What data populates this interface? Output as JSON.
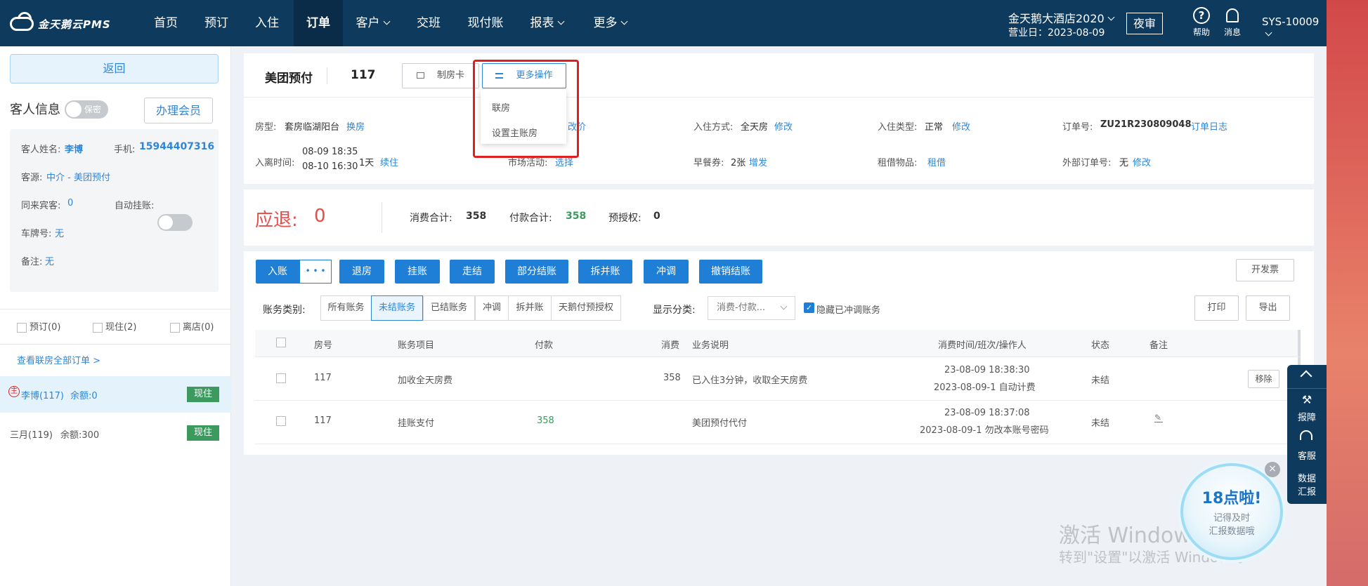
{
  "topbar": {
    "logo_text": "金天鹅云PMS",
    "nav": [
      "首页",
      "预订",
      "入住",
      "订单",
      "客户",
      "交班",
      "现付账",
      "报表",
      "更多"
    ],
    "active_nav": "订单",
    "hotel_name": "金天鹅大酒店2020",
    "business_date": "营业日：2023-08-09",
    "night_audit": "夜审",
    "help": "帮助",
    "messages": "消息",
    "user": "SYS-10009"
  },
  "left": {
    "back": "返回",
    "guest_info_title": "客人信息",
    "privacy": "保密",
    "member_btn": "办理会员",
    "name_label": "客人姓名:",
    "name": "李博",
    "phone_label": "手机:",
    "phone": "15944407316",
    "source_label": "客源:",
    "source": "中介 - 美团预付",
    "companion_label": "同来宾客:",
    "companion": "0",
    "auto_label": "自动挂账:",
    "plate_label": "车牌号:",
    "plate": "无",
    "remark_label": "备注:",
    "remark": "无",
    "tabs": [
      "预订(0)",
      "现住(2)",
      "离店(0)"
    ],
    "view_all": "查看联房全部订单 >",
    "rooms": [
      {
        "mark": "主",
        "name": "李博(117)",
        "balance": "余额:0",
        "status": "现住"
      },
      {
        "name": "三月(119)",
        "balance": "余额:300",
        "status": "现住"
      }
    ]
  },
  "order": {
    "channel": "美团预付",
    "room_no": "117",
    "make_card": "制房卡",
    "more_ops": "更多操作",
    "dropdown": [
      "联房",
      "设置主账房"
    ],
    "room_type_label": "房型:",
    "room_type": "套房临湖阳台",
    "change_room": "换房",
    "change_price": "改价",
    "checkin_method_label": "入住方式:",
    "checkin_method": "全天房",
    "modify": "修改",
    "checkin_type_label": "入住类型:",
    "checkin_type": "正常",
    "order_no_label": "订单号:",
    "order_no": "ZU21R230809048",
    "order_log": "订单日志",
    "stay_label": "入离时间:",
    "stay_in": "08-09 18:35",
    "stay_out": "08-10 16:30",
    "nights": "1天",
    "extend": "续住",
    "market_label": "市场活动:",
    "select": "选择",
    "breakfast_label": "早餐券:",
    "breakfast": "2张",
    "add_issue": "增发",
    "borrow_label": "租借物品:",
    "borrow": "租借",
    "ext_order_label": "外部订单号:",
    "ext_order": "无"
  },
  "summary": {
    "refund_label": "应退:",
    "refund": "0",
    "consume_label": "消费合计:",
    "consume": "358",
    "pay_label": "付款合计:",
    "pay": "358",
    "preauth_label": "预授权:",
    "preauth": "0"
  },
  "actions": {
    "buttons": [
      "入账",
      "退房",
      "挂账",
      "走结",
      "部分结账",
      "拆并账",
      "冲调",
      "撤销结账"
    ],
    "more": "• • •",
    "invoice": "开发票",
    "print": "打印",
    "export": "导出",
    "category_label": "账务类别:",
    "category_tabs": [
      "所有账务",
      "未结账务",
      "已结账务",
      "冲调",
      "拆并账",
      "天鹅付预授权"
    ],
    "selected_tab": "未结账务",
    "display_label": "显示分类:",
    "display_value": "消费-付款...",
    "hide_label": "隐藏已冲调账务"
  },
  "table": {
    "headers": [
      "房号",
      "账务项目",
      "付款",
      "消费",
      "业务说明",
      "消费时间/班次/操作人",
      "状态",
      "备注"
    ],
    "rows": [
      {
        "room": "117",
        "item": "加收全天房费",
        "pay": "",
        "consume": "358",
        "desc": "已入住3分钟，收取全天房费",
        "time": "23-08-09 18:38:30",
        "shift": "2023-08-09-1 自动计费",
        "status": "未结",
        "action": "移除"
      },
      {
        "room": "117",
        "item": "挂账支付",
        "pay": "358",
        "consume": "",
        "desc": "美团预付代付",
        "time": "23-08-09 18:37:08",
        "shift": "2023-08-09-1 勿改本账号密码",
        "status": "未结"
      }
    ]
  },
  "float": {
    "items": [
      "报障",
      "客服",
      "数据",
      "汇报"
    ]
  },
  "promo": {
    "title": "18点啦!",
    "line1": "记得及时",
    "line2": "汇报数据哦"
  },
  "watermark": {
    "line1": "激活 Windows",
    "line2": "转到\"设置\"以激活 Windows。"
  }
}
